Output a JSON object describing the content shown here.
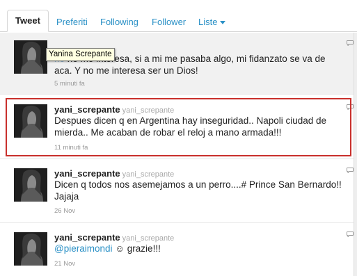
{
  "tabs": {
    "tweet": "Tweet",
    "preferiti": "Preferiti",
    "following": "Following",
    "follower": "Follower",
    "liste": "Liste"
  },
  "tooltip": "Yanina Screpante",
  "tweets": [
    {
      "mention_fragment": "ho",
      "text": "no me interesa, si a mi me pasaba algo, mi fidanzato se va de aca. Y no me interesa ser un Dios!",
      "time": "5 minuti fa"
    },
    {
      "screen_name": "yani_screpante",
      "handle": "yani_screpante",
      "text": "Despues dicen q en Argentina hay inseguridad.. Napoli ciudad de mierda.. Me acaban de robar el reloj a mano armada!!!",
      "time": "11 minuti fa"
    },
    {
      "screen_name": "yani_screpante",
      "handle": "yani_screpante",
      "text": "Dicen q todos nos asemejamos a un perro....# Prince San Bernardo!! Jajaja",
      "time": "26 Nov"
    },
    {
      "screen_name": "yani_screpante",
      "handle": "yani_screpante",
      "mention": "@pieraimondi",
      "text_after": "☺ grazie!!!",
      "time": "21 Nov"
    }
  ],
  "colors": {
    "link": "#2a90c6",
    "highlight": "#c9302c",
    "selected_row": "#f1f1f1",
    "tooltip_bg": "#ffffe1"
  },
  "icons": {
    "reply": "speech-bubble-icon",
    "menu_caret": "chevron-down-icon"
  }
}
